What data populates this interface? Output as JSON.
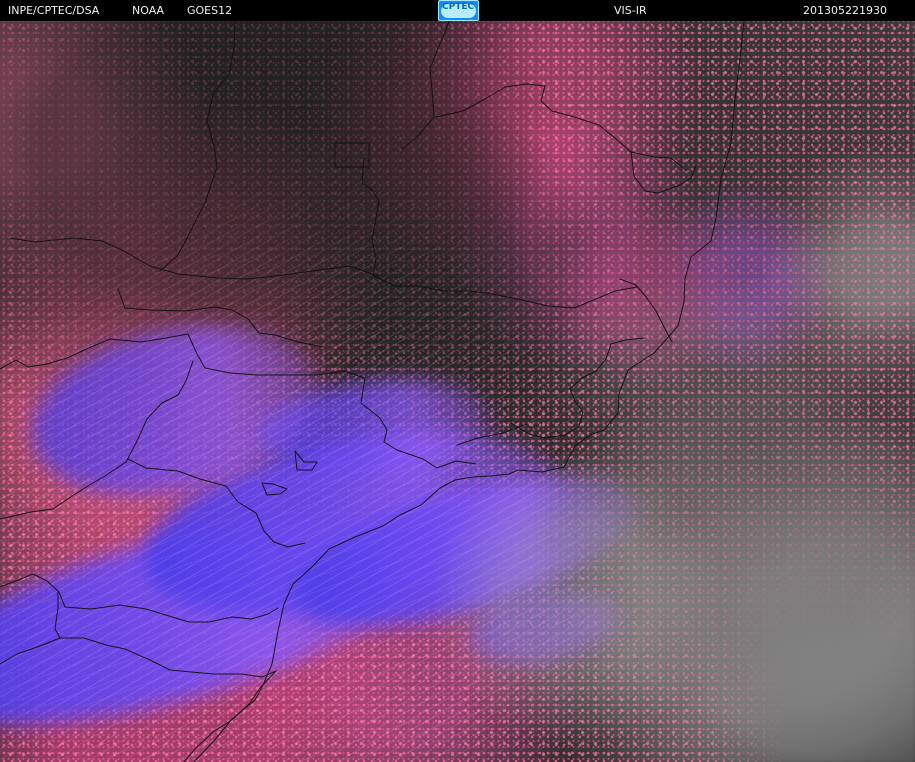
{
  "header": {
    "source": "INPE/CPTEC/DSA",
    "agency": "NOAA",
    "satellite": "GOES12",
    "logo_text": "CPTEC",
    "product": "VIS-IR",
    "timestamp": "201305221930"
  },
  "colors": {
    "background": "#000000",
    "header_text": "#f2f2f2",
    "logo_blue": "#0f8fff",
    "land_pink": "#e84b8f",
    "cloud_blue": "#4a3ce8",
    "ocean_gray": "#2b2b2b"
  }
}
